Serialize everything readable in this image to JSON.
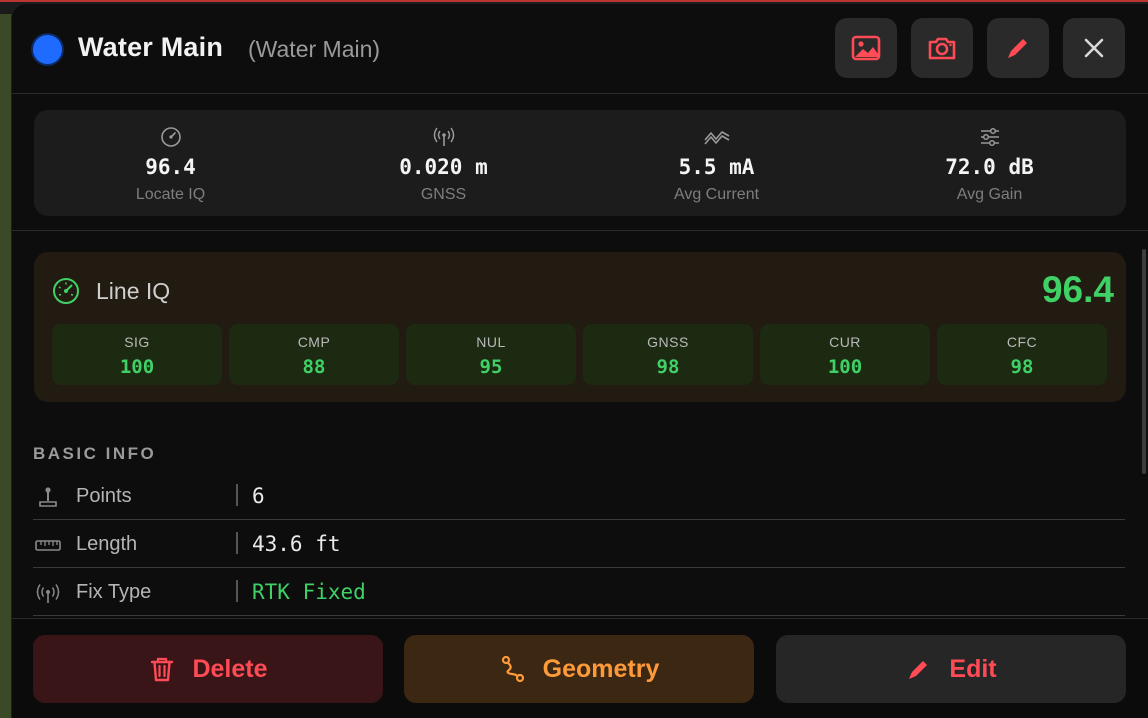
{
  "header": {
    "title": "Water Main",
    "subtitle": "(Water Main)",
    "status_color": "#1f6bff",
    "actions": [
      "image-icon",
      "camera-icon",
      "pencil-icon",
      "close-icon"
    ]
  },
  "stats": [
    {
      "icon": "gauge-icon",
      "value": "96.4",
      "label": "Locate IQ"
    },
    {
      "icon": "antenna-icon",
      "value": "0.020 m",
      "label": "GNSS"
    },
    {
      "icon": "signal-wave-icon",
      "value": "5.5 mA",
      "label": "Avg Current"
    },
    {
      "icon": "sliders-icon",
      "value": "72.0 dB",
      "label": "Avg Gain"
    }
  ],
  "line_iq": {
    "title": "Line IQ",
    "score": "96.4",
    "metrics": [
      {
        "label": "SIG",
        "value": "100"
      },
      {
        "label": "CMP",
        "value": "88"
      },
      {
        "label": "NUL",
        "value": "95"
      },
      {
        "label": "GNSS",
        "value": "98"
      },
      {
        "label": "CUR",
        "value": "100"
      },
      {
        "label": "CFC",
        "value": "98"
      }
    ],
    "accent_color": "#3fd066"
  },
  "basic_info": {
    "title": "BASIC INFO",
    "rows": [
      {
        "icon": "joystick-icon",
        "label": "Points",
        "value": "6"
      },
      {
        "icon": "ruler-icon",
        "label": "Length",
        "value": "43.6 ft"
      },
      {
        "icon": "antenna-icon",
        "label": "Fix Type",
        "value": "RTK Fixed"
      }
    ]
  },
  "footer": {
    "delete_label": "Delete",
    "geometry_label": "Geometry",
    "edit_label": "Edit"
  }
}
